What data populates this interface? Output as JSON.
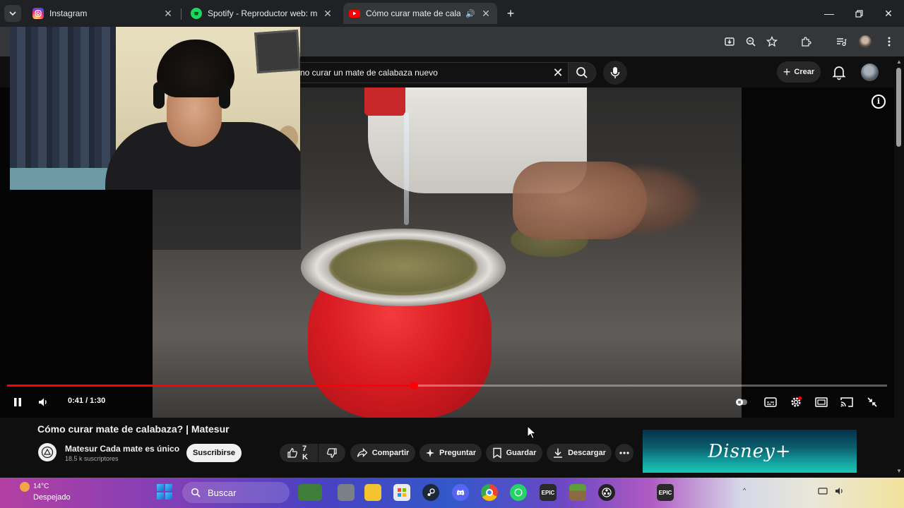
{
  "browser": {
    "tabs": [
      {
        "title": "Instagram",
        "favicon": "instagram-icon",
        "active": false
      },
      {
        "title": "Spotify - Reproductor web: mús",
        "favicon": "spotify-icon",
        "active": false
      },
      {
        "title": "Cómo curar mate de calaba",
        "favicon": "youtube-icon",
        "active": true
      }
    ],
    "new_tab": "+",
    "window_controls": [
      "minimize-icon",
      "restore-icon",
      "close-icon"
    ],
    "toolbar_icons": [
      "install-icon",
      "zoom-icon",
      "star-icon",
      "extensions-icon",
      "media-icon",
      "profile-icon",
      "menu-icon"
    ]
  },
  "youtube": {
    "search_query": "no curar un mate de calabaza nuevo",
    "create_label": "Crear",
    "colors": {
      "accent": "#ff0000",
      "background": "#0f0f0f",
      "chip": "#272727"
    }
  },
  "player": {
    "time": "0:41 / 1:30",
    "progress_fraction": 0.462,
    "info": "i"
  },
  "video": {
    "title": "Cómo curar mate de calabaza? | Matesur",
    "channel_name": "Matesur Cada mate es único",
    "subscribers": "18.5 k suscriptores",
    "subscribe_label": "Suscribirse",
    "likes": "7 K",
    "actions": {
      "share": "Compartir",
      "ask": "Preguntar",
      "save": "Guardar",
      "download": "Descargar"
    }
  },
  "ad": {
    "brand": "Disney+"
  },
  "taskbar": {
    "temperature": "14°C",
    "condition": "Despejado",
    "search_placeholder": "Buscar",
    "apps": [
      "game-icon",
      "files-icon",
      "folder-icon",
      "store-icon",
      "steam-icon",
      "discord-icon",
      "chrome-icon",
      "whatsapp-icon",
      "epic-games-icon",
      "minecraft-icon",
      "obs-icon",
      "epic-games-icon"
    ],
    "epic_label": "EPIC"
  }
}
